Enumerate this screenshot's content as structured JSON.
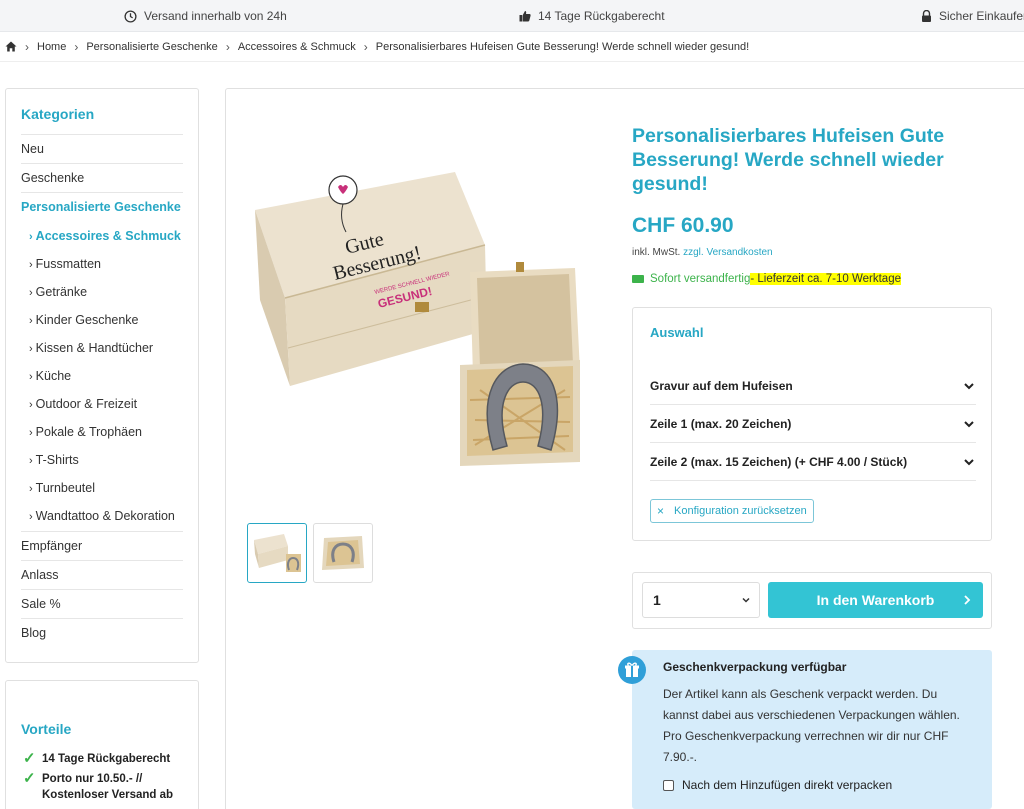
{
  "topbar": {
    "usp_shipping": "Versand innerhalb von 24h",
    "usp_return": "14 Tage Rückgaberecht",
    "usp_secure": "Sicher Einkaufen"
  },
  "breadcrumb": {
    "items": [
      "Home",
      "Personalisierte Geschenke",
      "Accessoires & Schmuck",
      "Personalisierbares Hufeisen Gute Besserung! Werde schnell wieder gesund!"
    ]
  },
  "sidebar": {
    "title": "Kategorien",
    "items_top": [
      "Neu",
      "Geschenke",
      "Personalisierte Geschenke"
    ],
    "subitems": [
      "Accessoires & Schmuck",
      "Fussmatten",
      "Getränke",
      "Kinder Geschenke",
      "Kissen & Handtücher",
      "Küche",
      "Outdoor & Freizeit",
      "Pokale & Trophäen",
      "T-Shirts",
      "Turnbeutel",
      "Wandtattoo & Dekoration"
    ],
    "items_bottom": [
      "Empfänger",
      "Anlass",
      "Sale %",
      "Blog"
    ]
  },
  "advantages": {
    "title": "Vorteile",
    "items": [
      "14 Tage Rückgaberecht",
      "Porto nur 10.50.- // Kostenloser Versand ab"
    ]
  },
  "product": {
    "title": "Personalisierbares Hufeisen Gute Besserung! Werde schnell wieder gesund!",
    "price": "CHF 60.90",
    "tax_prefix": "inkl. MwSt.",
    "tax_link": "zzgl. Versandkosten",
    "delivery_status": "Sofort versandfertig",
    "delivery_time": "- Lieferzeit ca. 7-10 Werktage",
    "image_box_text_1": "Gute",
    "image_box_text_2": "Besserung!",
    "image_box_text_3": "WERDE SCHNELL WIEDER",
    "image_box_text_4": "GESUND!"
  },
  "config": {
    "title": "Auswahl",
    "rows": [
      "Gravur auf dem Hufeisen",
      "Zeile 1 (max. 20 Zeichen)",
      "Zeile 2 (max. 15 Zeichen) (+ CHF 4.00 / Stück)"
    ],
    "reset_label": "Konfiguration zurücksetzen"
  },
  "cart": {
    "quantity": "1",
    "button_label": "In den Warenkorb"
  },
  "gift": {
    "title": "Geschenkverpackung verfügbar",
    "text": "Der Artikel kann als Geschenk verpackt werden. Du kannst dabei aus verschiedenen Verpackungen wählen. Pro Geschenkverpackung verrechnen wir dir nur CHF 7.90.-.",
    "checkbox_label": "Nach dem Hinzufügen direkt verpacken"
  },
  "colors": {
    "accent": "#27a7c4",
    "cart_button": "#33c4d4",
    "success": "#3cb34b",
    "gift_bg": "#d6ecfa"
  }
}
